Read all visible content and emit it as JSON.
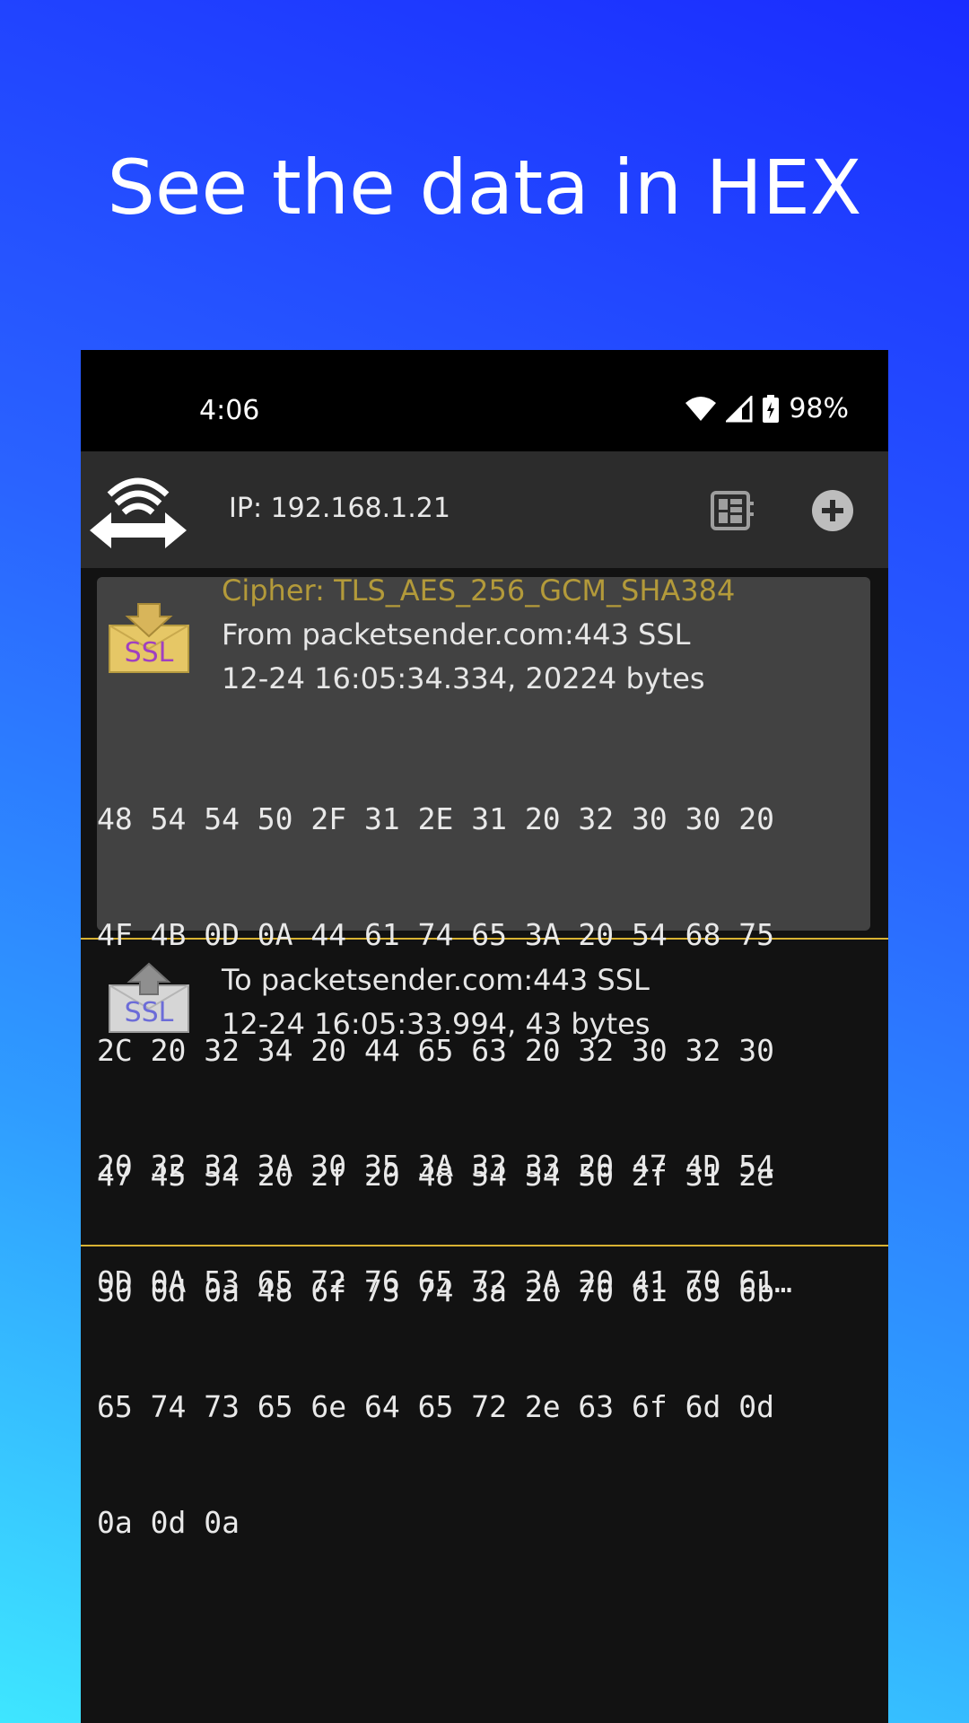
{
  "headline": "See the data in HEX",
  "status": {
    "time": "4:06",
    "battery": "98%"
  },
  "appbar": {
    "ip": "IP: 192.168.1.21"
  },
  "packets": [
    {
      "cipher": "Cipher: TLS_AES_256_GCM_SHA384",
      "source": "From packetsender.com:443 SSL",
      "meta": "12-24 16:05:34.334, 20224 bytes",
      "hex": [
        "48 54 54 50 2F 31 2E 31 20 32 30 30 20",
        "4F 4B 0D 0A 44 61 74 65 3A 20 54 68 75",
        "2C 20 32 34 20 44 65 63 20 32 30 32 30",
        "20 32 32 3A 30 35 3A 33 33 20 47 4D 54",
        "0D 0A 53 65 72 76 65 72 3A 20 41 70 61…"
      ]
    },
    {
      "source": "To packetsender.com:443 SSL",
      "meta": "12-24 16:05:33.994, 43 bytes",
      "hex": [
        "47 45 54 20 2f 20 48 54 54 50 2f 31 2e",
        "30 0d 0a 48 6f 73 74 3a 20 70 61 63 6b",
        "65 74 73 65 6e 64 65 72 2e 63 6f 6d 0d",
        "0a 0d 0a"
      ]
    }
  ],
  "icons": {
    "wifi": "wifi-icon",
    "signal": "signal-icon",
    "battery": "battery-icon",
    "logo": "packet-sender-logo",
    "layout": "dashboard-icon",
    "add": "add-icon",
    "incoming": "ssl-incoming-icon",
    "outgoing": "ssl-outgoing-icon"
  },
  "colors": {
    "cipher": "#b39a3a",
    "divider": "#d8b233",
    "ssl_text": "#a040c0"
  }
}
